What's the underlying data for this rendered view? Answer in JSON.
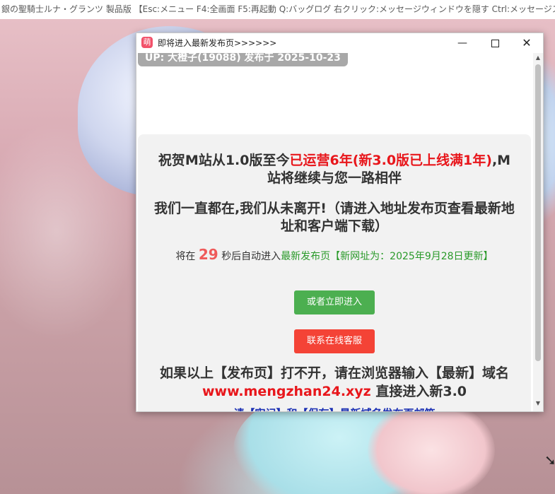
{
  "game_window": {
    "title": "銀の聖騎士ルナ・グランツ 製品版 【Esc:メニュー F4:全画面 F5:再起動 Q:バッグログ 右クリック:メッセージウィンドウを隠す Ctrl:メッセージスキップ"
  },
  "popup": {
    "title": "即将进入最新发布页>>>>>>",
    "app_icon": "萌",
    "minimize_glyph": "—",
    "close_glyph": "✕"
  },
  "page": {
    "up_badge": "UP: 大橙子(19088) 发布于 2025-10-23",
    "headline1_part1": "祝贺M站从1.0版至今",
    "headline1_highlight": "已运营6年(新3.0版已上线满1年)",
    "headline1_part2": ",M站将继续与您一路相伴",
    "headline2": "我们一直都在,我们从未离开!（请进入地址发布页查看最新地址和客户端下载）",
    "countdown_prefix": "将在",
    "countdown_number": "29",
    "countdown_suffix": "秒后自动进入",
    "countdown_green": "最新发布页【新网址为：2025年9月28日更新】",
    "enter_button": "或者立即进入",
    "support_button": "联系在线客服",
    "note_part1": "如果以上【发布页】打不开，请在浏览器输入【最新】域名",
    "note_domain": "www.mengzhan24.xyz",
    "note_part2": "直接进入新3.0",
    "blue_line": "请【牢记】和【保存】最新域名发布页邮箱"
  },
  "colors": {
    "accent_red": "#e8161b",
    "green_button": "#4caf50",
    "red_button": "#f44336",
    "countdown_number": "#ef5b5b"
  }
}
